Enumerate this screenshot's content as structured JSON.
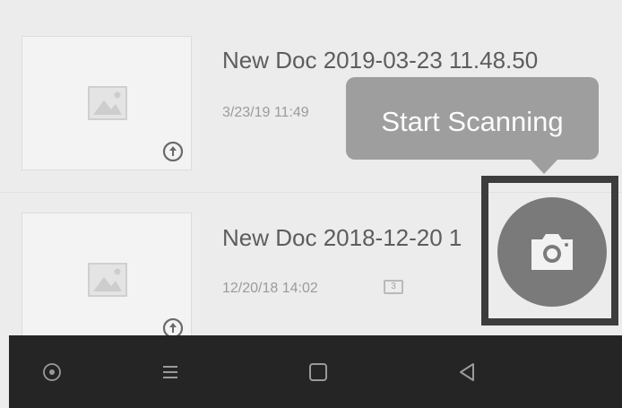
{
  "documents": [
    {
      "title": "New Doc 2019-03-23 11.48.50",
      "date": "3/23/19 11:49",
      "page_count": "",
      "status_icon": "sync-icon"
    },
    {
      "title": "New Doc 2018-12-20 1",
      "date": "12/20/18 14:02",
      "page_count": "3",
      "status_icon": "sync-icon"
    }
  ],
  "tooltip": {
    "text": "Start Scanning"
  },
  "fab": {
    "icon": "camera-icon"
  },
  "navbar": {
    "buttons": [
      "assistant-icon",
      "recents-icon",
      "home-icon",
      "back-icon"
    ]
  },
  "colors": {
    "background": "#ececec",
    "tooltip": "#9e9e9e",
    "fab": "#7a7a7a",
    "navbar": "#252525"
  }
}
